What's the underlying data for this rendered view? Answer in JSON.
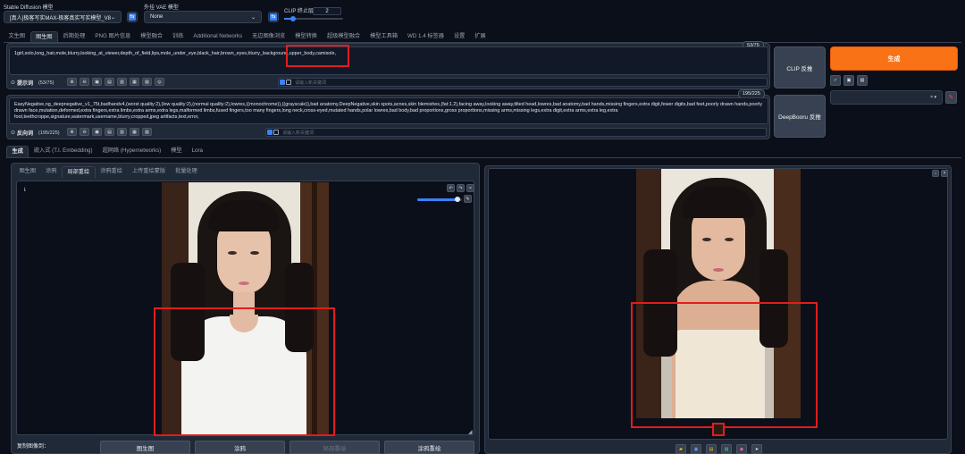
{
  "top": {
    "sd_label": "Stable Diffusion 模型",
    "sd_value": "[真人]极客写实MAX-极客真实写实模型_V8.safet",
    "vae_label": "外挂 VAE 模型",
    "vae_value": "None",
    "clip_label": "CLIP 终止层数",
    "clip_value": "2",
    "refresh_glyph": "⇆"
  },
  "tabs": [
    "文生图",
    "图生图",
    "后期处理",
    "PNG 图片信息",
    "模型融合",
    "训练",
    "Additional Networks",
    "无边图像浏览",
    "模型转换",
    "超级模型融合",
    "模型工具箱",
    "WD 1.4 标签器",
    "设置",
    "扩展"
  ],
  "prompt": {
    "text": "1girl,solo,long_hair,mole,blurry,looking_at_viewer,depth_of_field,lips,mole_under_eye,black_hair,brown_eyes,blurry_background,upper_body,camisole,",
    "counter": "53/75",
    "label": "提示词",
    "label_count": "(53/75)",
    "checkbox_text": "请输入新关键词"
  },
  "negative": {
    "text": "EasyNegative,ng_deepnegative_v1_75t,badhandv4,(worst quality:2),(low quality:2),(normal quality:2),lowres,((monochrome)),((grayscale)),bad anatomy,DeepNegative,skin spots,acnes,skin blemishes,(fat:1.2),facing away,looking away,tilted head,lowres,bad anatomy,bad hands,missing fingers,extra digit,fewer digits,bad feet,poorly drawn hands,poorly drawn face,mutation,deformed,extra fingers,extra limbs,extra arms,extra legs,malformed limbs,fused fingers,too many fingers,long neck,cross-eyed,mutated hands,polar lowres,bad body,bad proportions,gross proportions,missing arms,missing legs,extra digit,extra arms,extra leg,extra foot,teethcroppe,signature,watermark,username,blurry,cropped,jpeg artifacts,text,error,",
    "counter": "195/225",
    "label": "反向词",
    "label_count": "(195/225)",
    "checkbox_text": "请输入新关键词"
  },
  "side": {
    "clip_btn": "CLIP 反推",
    "deepbooru_btn": "DeepBooru 反推",
    "generate_btn": "生成",
    "style_clear": "× ▾"
  },
  "subtabs": [
    "生成",
    "嵌入式 (T.I. Embedding)",
    "超网络 (Hypernetworks)",
    "模型",
    "Lora"
  ],
  "modetabs": [
    "图生图",
    "涂鸦",
    "局部重绘",
    "涂鸦重绘",
    "上传重绘蒙版",
    "批量处理"
  ],
  "bottom": {
    "copy_label": "复制图像到：",
    "buttons": [
      "图生图",
      "涂鸦",
      "局部重绘",
      "涂鸦重绘"
    ]
  },
  "icons": [
    "folder-icon",
    "save-icon",
    "zip-icon",
    "image-icon",
    "palette-icon",
    "send-icon"
  ]
}
